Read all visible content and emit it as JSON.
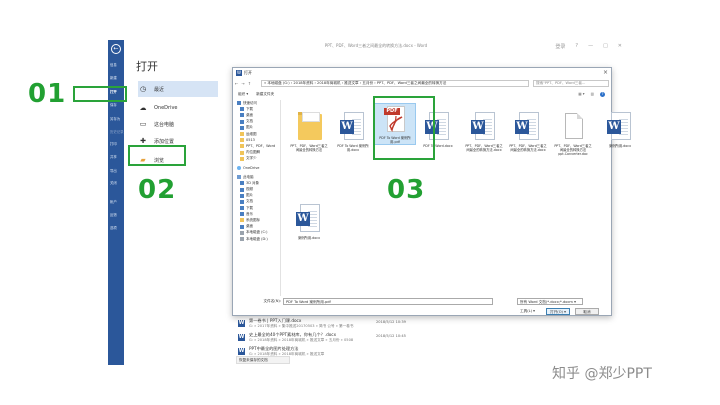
{
  "word": {
    "title": "PPT、PDF、Word三者之间最全的转换方法.docx - Word",
    "window_controls": [
      "登录",
      "?",
      "—",
      "□",
      "✕"
    ],
    "rail_items": [
      "信息",
      "新建",
      "打开",
      "保存",
      "另存为",
      "历史记录",
      "打印",
      "共享",
      "导出",
      "关闭",
      "帐户",
      "反馈",
      "选项"
    ],
    "rail_selected": "打开",
    "open_title": "打开",
    "locations": [
      {
        "label": "最近",
        "icon": "clock-icon"
      },
      {
        "label": "OneDrive",
        "icon": "cloud-icon"
      },
      {
        "label": "这台电脑",
        "icon": "computer-icon"
      },
      {
        "label": "添加位置",
        "icon": "plus-icon"
      },
      {
        "label": "浏览",
        "icon": "folder-icon"
      }
    ]
  },
  "dialog": {
    "title": "打开",
    "breadcrumb": "« 本地磁盘 (G:) › 2018年资料 › 2018年商城机 › 推送文章 › 五月份 › PPT、PDF、Word三者之间最全的转换方法",
    "search_placeholder": "搜索\"PPT、PDF、Word三者...",
    "organize": "组织 ▾",
    "new_folder": "新建文件夹",
    "nav_tree": [
      {
        "label": "快速访问",
        "kind": "blue",
        "lvl": 0
      },
      {
        "label": "下载",
        "kind": "blue",
        "lvl": 1
      },
      {
        "label": "桌面",
        "kind": "blue",
        "lvl": 1
      },
      {
        "label": "文档",
        "kind": "blue",
        "lvl": 1
      },
      {
        "label": "图片",
        "kind": "blue",
        "lvl": 1
      },
      {
        "label": "运维图",
        "kind": "folder",
        "lvl": 1
      },
      {
        "label": "0513",
        "kind": "folder",
        "lvl": 1
      },
      {
        "label": "PPT、PDF、Word",
        "kind": "folder",
        "lvl": 1
      },
      {
        "label": "内位图解",
        "kind": "folder",
        "lvl": 1
      },
      {
        "label": "文学少",
        "kind": "folder",
        "lvl": 1
      },
      {
        "label": "Microsoft Word",
        "kind": "word",
        "lvl": 0
      },
      {
        "label": "OneDrive",
        "kind": "cloud",
        "lvl": 0
      },
      {
        "label": "此电脑",
        "kind": "pc",
        "lvl": 0
      },
      {
        "label": "3D 对象",
        "kind": "blue",
        "lvl": 1
      },
      {
        "label": "视频",
        "kind": "blue",
        "lvl": 1
      },
      {
        "label": "图片",
        "kind": "blue",
        "lvl": 1
      },
      {
        "label": "文档",
        "kind": "blue",
        "lvl": 1
      },
      {
        "label": "下载",
        "kind": "blue",
        "lvl": 1
      },
      {
        "label": "音乐",
        "kind": "blue",
        "lvl": 1
      },
      {
        "label": "系统图标",
        "kind": "folder",
        "lvl": 1
      },
      {
        "label": "桌面",
        "kind": "blue",
        "lvl": 1
      },
      {
        "label": "本地磁盘 (C:)",
        "kind": "drive",
        "lvl": 1
      },
      {
        "label": "本地磁盘 (D:)",
        "kind": "drive",
        "lvl": 1
      }
    ],
    "files": [
      {
        "name": "PPT、PDF、Word三者之间最全的转换方法",
        "kind": "folder"
      },
      {
        "name": "PDF To Word 案例所用.docx",
        "kind": "word"
      },
      {
        "name": "PDF To Word 案例所用.pdf",
        "kind": "pdf"
      },
      {
        "name": "PDF To Word.docx",
        "kind": "word"
      },
      {
        "name": "PPT、PDF、Word三者之间最全的转换方法.docx",
        "kind": "word"
      },
      {
        "name": "PPT、PDF、Word三者之间最全的转换方法.docx",
        "kind": "word"
      },
      {
        "name": "PPT、PDF、Word三者之间最全的转换方法ppt.Converter.doc",
        "kind": "blank"
      },
      {
        "name": "案例所用.docx",
        "kind": "word"
      },
      {
        "name": "案例所用.docx",
        "kind": "word"
      }
    ],
    "filename_label": "文件名(N):",
    "filename_value": "PDF To Word 案例所用.pdf",
    "filetype_value": "所有 Word 文档(*.docx;*.docm ▾",
    "tools": "工具(L) ▾",
    "open_btn": "打开(O) ▾",
    "cancel_btn": "取消"
  },
  "recent": [
    {
      "title": "第一卷书 | PPT入门课.docx",
      "path": "G: » 2017年资料 » 集中推送20170503 » 简书 公号 » 第一卷书",
      "date": "2018/5/12 10:39"
    },
    {
      "title": "史上最全的40个PPT素材库，你有几个？.docx",
      "path": "G: » 2018年资料 » 2018年商城机 » 推送文章 » 五月份 » 0508",
      "date": "2018/5/12 10:45"
    },
    {
      "title": "PPT中最全的图片处理方法",
      "path": "G: » 2018年资料 » 2018年商城机 » 推送文章",
      "date": ""
    }
  ],
  "restore_label": "恢复未保存的文档",
  "annotations": [
    "01",
    "02",
    "03"
  ],
  "watermark": "知乎 @郑少PPT",
  "colors": {
    "word_blue": "#2b579a",
    "highlight_green": "#2aa33a",
    "pdf_red": "#c0392b"
  }
}
